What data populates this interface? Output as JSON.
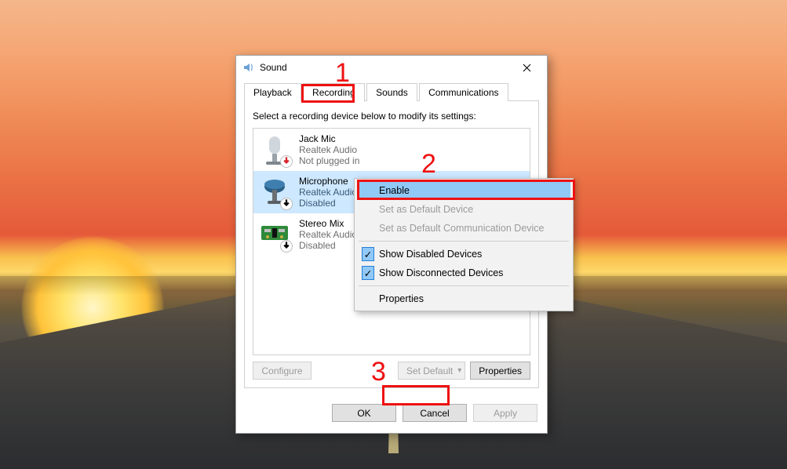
{
  "dialog": {
    "title": "Sound",
    "tabs": [
      "Playback",
      "Recording",
      "Sounds",
      "Communications"
    ],
    "active_tab": "Recording",
    "instruction": "Select a recording device below to modify its settings:",
    "devices": [
      {
        "name": "Jack Mic",
        "driver": "Realtek Audio",
        "status": "Not plugged in",
        "status_icon": "down-red"
      },
      {
        "name": "Microphone",
        "driver": "Realtek Audio",
        "status": "Disabled",
        "status_icon": "down-black",
        "selected": true
      },
      {
        "name": "Stereo Mix",
        "driver": "Realtek Audio",
        "status": "Disabled",
        "status_icon": "down-black"
      }
    ],
    "buttons": {
      "configure": "Configure",
      "set_default": "Set Default",
      "properties": "Properties",
      "ok": "OK",
      "cancel": "Cancel",
      "apply": "Apply"
    }
  },
  "context_menu": {
    "items": [
      {
        "label": "Enable",
        "highlight": true
      },
      {
        "label": "Set as Default Device",
        "disabled": true
      },
      {
        "label": "Set as Default Communication Device",
        "disabled": true
      },
      {
        "sep": true
      },
      {
        "label": "Show Disabled Devices",
        "checked": true
      },
      {
        "label": "Show Disconnected Devices",
        "checked": true
      },
      {
        "sep": true
      },
      {
        "label": "Properties"
      }
    ]
  },
  "annotations": {
    "n1": "1",
    "n2": "2",
    "n3": "3"
  }
}
